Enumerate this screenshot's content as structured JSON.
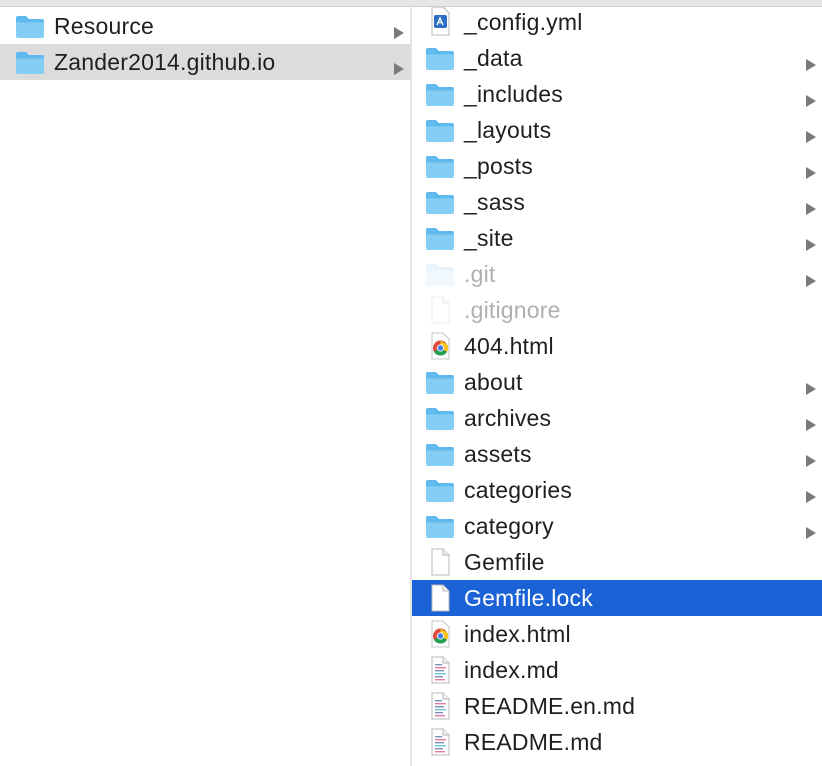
{
  "finder": {
    "left_column": [
      {
        "label": "Resource",
        "icon": "folder-icon",
        "has_children": true,
        "selected": false
      },
      {
        "label": "Zander2014.github.io",
        "icon": "folder-icon",
        "has_children": true,
        "selected": true
      }
    ],
    "right_column": [
      {
        "label": "_config.yml",
        "icon": "yml-file-icon",
        "has_children": false
      },
      {
        "label": "_data",
        "icon": "folder-icon",
        "has_children": true
      },
      {
        "label": "_includes",
        "icon": "folder-icon",
        "has_children": true
      },
      {
        "label": "_layouts",
        "icon": "folder-icon",
        "has_children": true
      },
      {
        "label": "_posts",
        "icon": "folder-icon",
        "has_children": true
      },
      {
        "label": "_sass",
        "icon": "folder-icon",
        "has_children": true
      },
      {
        "label": "_site",
        "icon": "folder-icon",
        "has_children": true
      },
      {
        "label": ".git",
        "icon": "folder-icon",
        "has_children": true,
        "hidden": true
      },
      {
        "label": ".gitignore",
        "icon": "document-icon",
        "has_children": false,
        "hidden": true
      },
      {
        "label": "404.html",
        "icon": "chrome-html-icon",
        "has_children": false
      },
      {
        "label": "about",
        "icon": "folder-icon",
        "has_children": true
      },
      {
        "label": "archives",
        "icon": "folder-icon",
        "has_children": true
      },
      {
        "label": "assets",
        "icon": "folder-icon",
        "has_children": true
      },
      {
        "label": "categories",
        "icon": "folder-icon",
        "has_children": true
      },
      {
        "label": "category",
        "icon": "folder-icon",
        "has_children": true
      },
      {
        "label": "Gemfile",
        "icon": "document-icon",
        "has_children": false
      },
      {
        "label": "Gemfile.lock",
        "icon": "document-icon",
        "has_children": false,
        "selected": true
      },
      {
        "label": "index.html",
        "icon": "chrome-html-icon",
        "has_children": false
      },
      {
        "label": "index.md",
        "icon": "markdown-file-icon",
        "has_children": false
      },
      {
        "label": "README.en.md",
        "icon": "markdown-file-icon",
        "has_children": false
      },
      {
        "label": "README.md",
        "icon": "markdown-file-icon",
        "has_children": false
      }
    ]
  },
  "colors": {
    "selection_active": "#1a62d6",
    "selection_inactive": "#dcdcdc",
    "folder": "#5fb9ee",
    "chevron": "#7a7a7a"
  }
}
